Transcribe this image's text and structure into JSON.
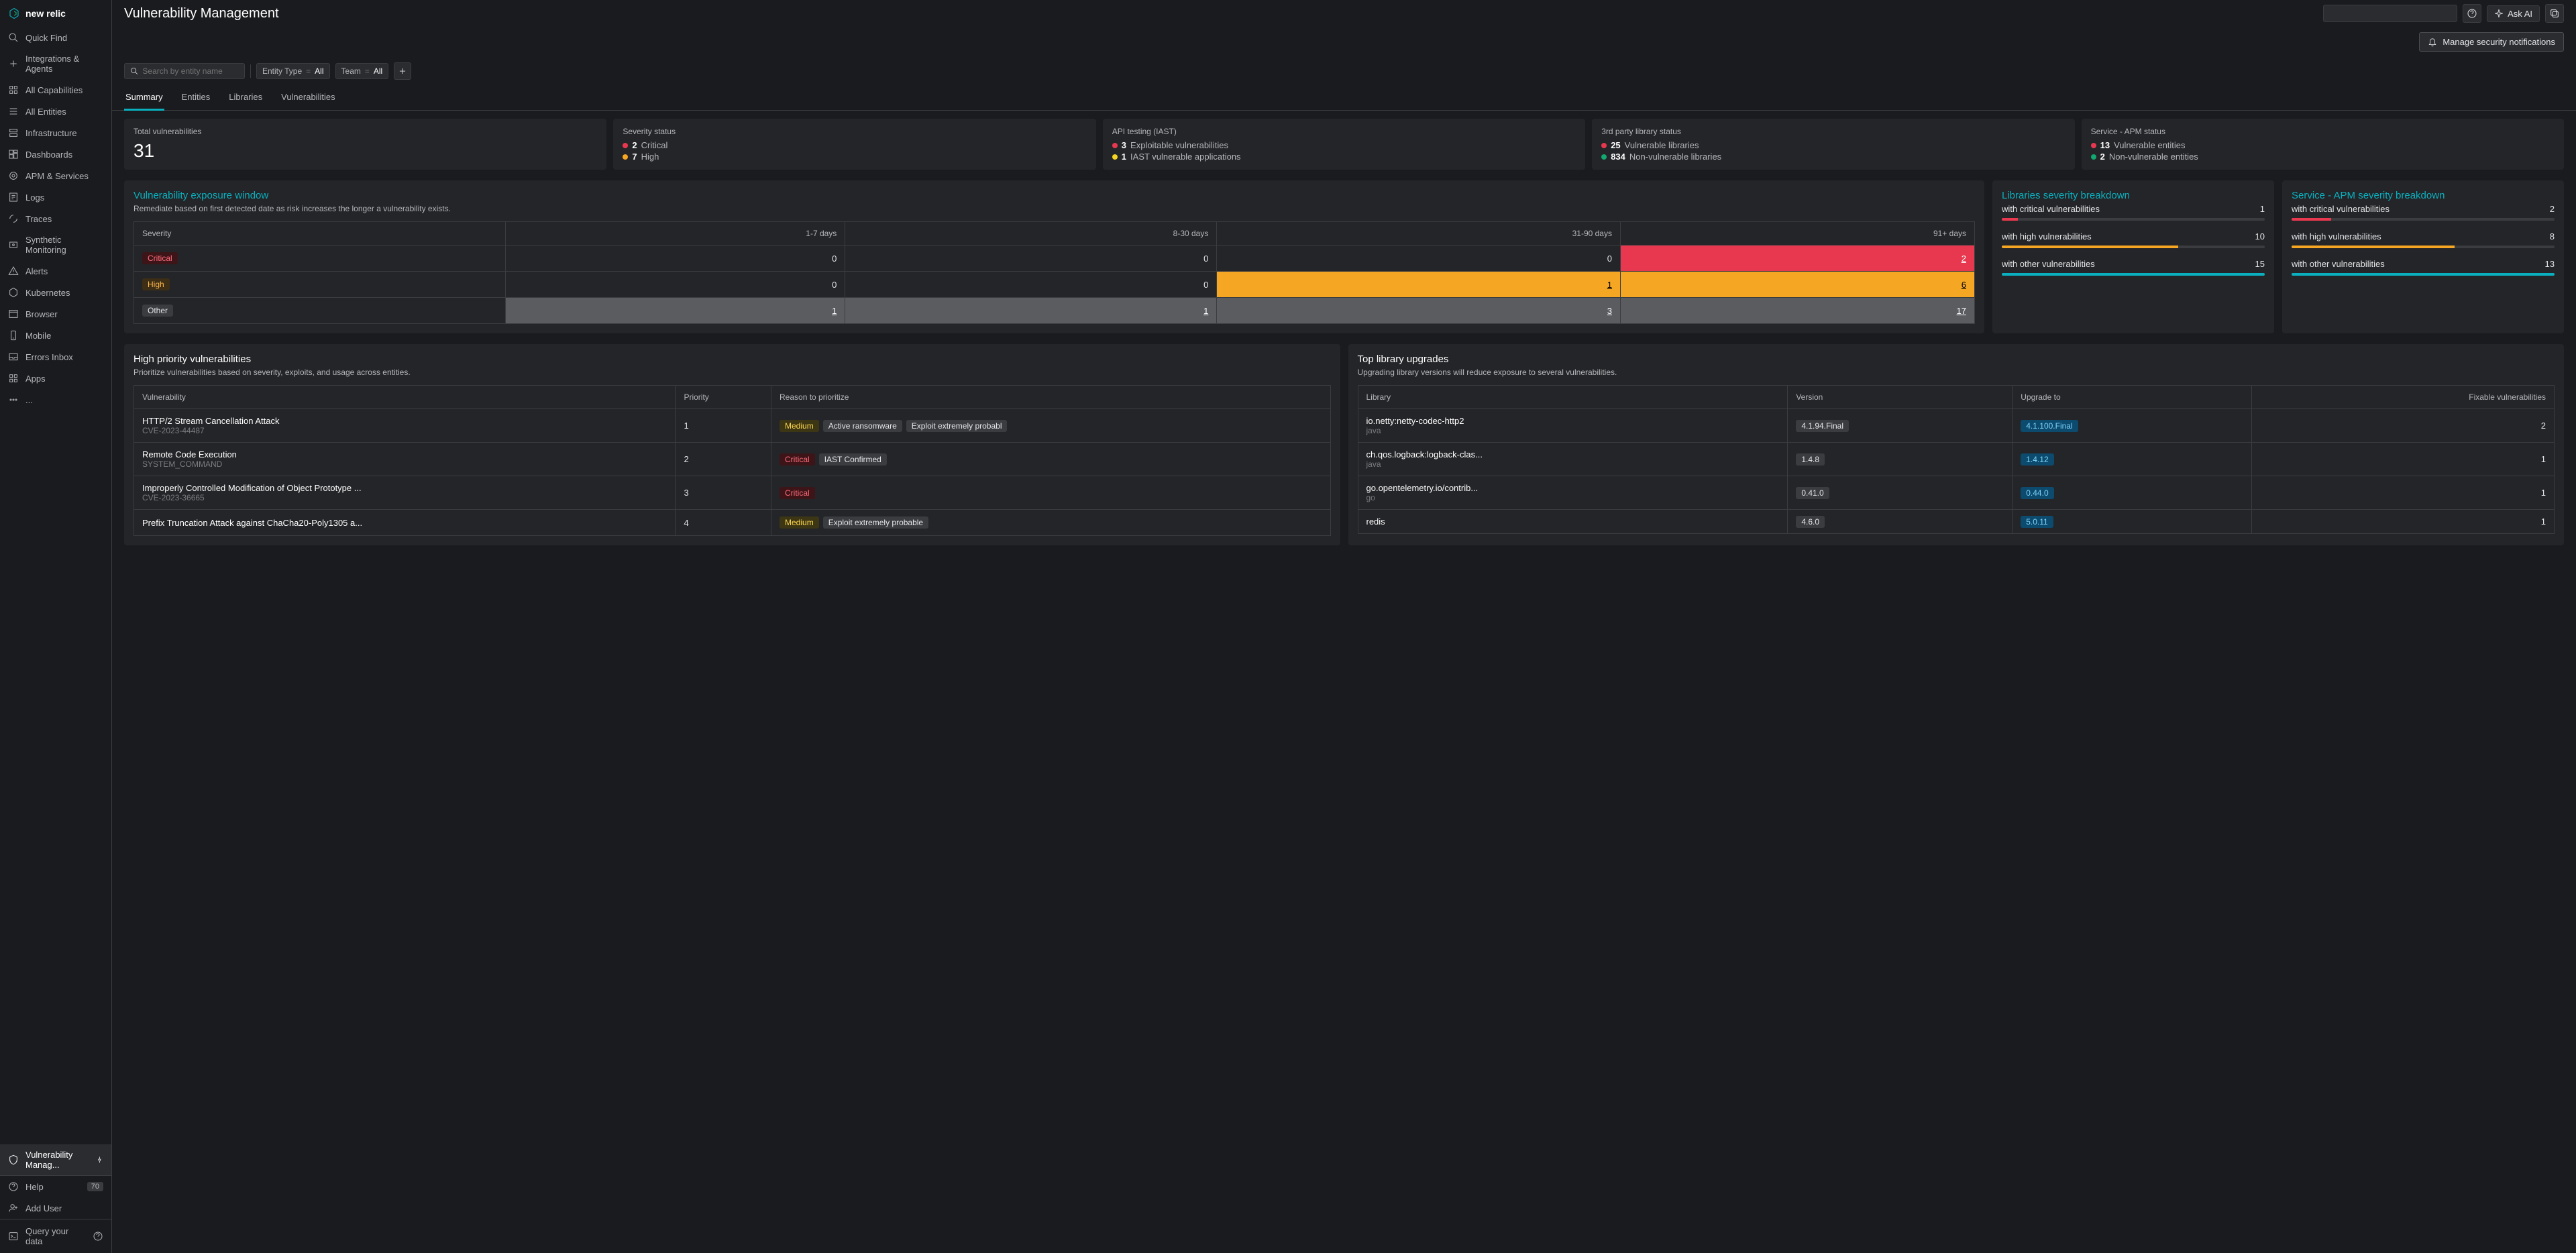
{
  "brand": "new relic",
  "header": {
    "title": "Vulnerability Management",
    "ask_ai": "Ask AI",
    "notif_button": "Manage security notifications"
  },
  "sidebar": {
    "items": [
      {
        "label": "Quick Find",
        "icon": "search-icon"
      },
      {
        "label": "Integrations & Agents",
        "icon": "plus-icon"
      },
      {
        "label": "All Capabilities",
        "icon": "grid-icon"
      },
      {
        "label": "All Entities",
        "icon": "list-icon"
      },
      {
        "label": "Infrastructure",
        "icon": "server-icon"
      },
      {
        "label": "Dashboards",
        "icon": "dashboard-icon"
      },
      {
        "label": "APM & Services",
        "icon": "apm-icon"
      },
      {
        "label": "Logs",
        "icon": "logs-icon"
      },
      {
        "label": "Traces",
        "icon": "traces-icon"
      },
      {
        "label": "Synthetic Monitoring",
        "icon": "synthetic-icon"
      },
      {
        "label": "Alerts",
        "icon": "alert-icon"
      },
      {
        "label": "Kubernetes",
        "icon": "kubernetes-icon"
      },
      {
        "label": "Browser",
        "icon": "browser-icon"
      },
      {
        "label": "Mobile",
        "icon": "mobile-icon"
      },
      {
        "label": "Errors Inbox",
        "icon": "inbox-icon"
      },
      {
        "label": "Apps",
        "icon": "apps-icon"
      },
      {
        "label": "...",
        "icon": "ellipsis-icon"
      }
    ],
    "active_label": "Vulnerability Manag...",
    "help_label": "Help",
    "help_badge": "70",
    "add_user": "Add User",
    "query_data": "Query your data"
  },
  "filters": {
    "search_placeholder": "Search by entity name",
    "chips": [
      {
        "key": "Entity Type",
        "op": "=",
        "val": "All"
      },
      {
        "key": "Team",
        "op": "=",
        "val": "All"
      }
    ]
  },
  "tabs": [
    "Summary",
    "Entities",
    "Libraries",
    "Vulnerabilities"
  ],
  "active_tab": "Summary",
  "stats": {
    "total": {
      "label": "Total vulnerabilities",
      "value": "31"
    },
    "severity": {
      "label": "Severity status",
      "rows": [
        {
          "dot": "red",
          "num": "2",
          "txt": "Critical"
        },
        {
          "dot": "orange",
          "num": "7",
          "txt": "High"
        }
      ]
    },
    "api": {
      "label": "API testing (IAST)",
      "rows": [
        {
          "dot": "red",
          "num": "3",
          "txt": "Exploitable vulnerabilities"
        },
        {
          "dot": "yellow",
          "num": "1",
          "txt": "IAST vulnerable applications"
        }
      ]
    },
    "third_party": {
      "label": "3rd party library status",
      "rows": [
        {
          "dot": "red",
          "num": "25",
          "txt": "Vulnerable libraries"
        },
        {
          "dot": "green",
          "num": "834",
          "txt": "Non-vulnerable libraries"
        }
      ]
    },
    "service": {
      "label": "Service - APM status",
      "rows": [
        {
          "dot": "red",
          "num": "13",
          "txt": "Vulnerable entities"
        },
        {
          "dot": "green",
          "num": "2",
          "txt": "Non-vulnerable entities"
        }
      ]
    }
  },
  "exposure": {
    "title": "Vulnerability exposure window",
    "subtitle": "Remediate based on first detected date as risk increases the longer a vulnerability exists.",
    "columns": [
      "Severity",
      "1-7 days",
      "8-30 days",
      "31-90 days",
      "91+ days"
    ],
    "rows": [
      {
        "sev": "Critical",
        "cls": "critical",
        "cells": [
          {
            "v": "0"
          },
          {
            "v": "0"
          },
          {
            "v": "0"
          },
          {
            "v": "2",
            "bg": "cell-red",
            "link": true
          }
        ]
      },
      {
        "sev": "High",
        "cls": "high",
        "cells": [
          {
            "v": "0"
          },
          {
            "v": "0"
          },
          {
            "v": "1",
            "bg": "cell-orange",
            "link": true
          },
          {
            "v": "6",
            "bg": "cell-orange",
            "link": true
          }
        ]
      },
      {
        "sev": "Other",
        "cls": "other",
        "cells": [
          {
            "v": "1",
            "bg": "cell-gray",
            "link": true
          },
          {
            "v": "1",
            "bg": "cell-gray",
            "link": true
          },
          {
            "v": "3",
            "bg": "cell-gray",
            "link": true
          },
          {
            "v": "17",
            "bg": "cell-gray",
            "link": true
          }
        ]
      }
    ]
  },
  "lib_breakdown": {
    "title": "Libraries severity breakdown",
    "items": [
      {
        "label": "with critical vulnerabilities",
        "count": "1",
        "fill": "red",
        "pct": 6
      },
      {
        "label": "with high vulnerabilities",
        "count": "10",
        "fill": "orange",
        "pct": 67
      },
      {
        "label": "with other vulnerabilities",
        "count": "15",
        "fill": "teal",
        "pct": 100
      }
    ]
  },
  "svc_breakdown": {
    "title": "Service - APM severity breakdown",
    "items": [
      {
        "label": "with critical vulnerabilities",
        "count": "2",
        "fill": "red",
        "pct": 15
      },
      {
        "label": "with high vulnerabilities",
        "count": "8",
        "fill": "orange",
        "pct": 62
      },
      {
        "label": "with other vulnerabilities",
        "count": "13",
        "fill": "teal",
        "pct": 100
      }
    ]
  },
  "priority": {
    "title": "High priority vulnerabilities",
    "subtitle": "Prioritize vulnerabilities based on severity, exploits, and usage across entities.",
    "columns": [
      "Vulnerability",
      "Priority",
      "Reason to prioritize"
    ],
    "rows": [
      {
        "name": "HTTP/2 Stream Cancellation Attack",
        "cve": "CVE-2023-44487",
        "priority": "1",
        "reasons": [
          {
            "txt": "Medium",
            "cls": "medium"
          },
          {
            "txt": "Active ransomware"
          },
          {
            "txt": "Exploit extremely probabl"
          }
        ]
      },
      {
        "name": "Remote Code Execution",
        "cve": "SYSTEM_COMMAND",
        "priority": "2",
        "reasons": [
          {
            "txt": "Critical",
            "cls": "critical"
          },
          {
            "txt": "IAST Confirmed"
          }
        ]
      },
      {
        "name": "Improperly Controlled Modification of Object Prototype ...",
        "cve": "CVE-2023-36665",
        "priority": "3",
        "reasons": [
          {
            "txt": "Critical",
            "cls": "critical"
          }
        ]
      },
      {
        "name": "Prefix Truncation Attack against ChaCha20-Poly1305 a...",
        "cve": "",
        "priority": "4",
        "reasons": [
          {
            "txt": "Medium",
            "cls": "medium"
          },
          {
            "txt": "Exploit extremely probable"
          }
        ]
      }
    ]
  },
  "upgrades": {
    "title": "Top library upgrades",
    "subtitle": "Upgrading library versions will reduce exposure to several vulnerabilities.",
    "columns": [
      "Library",
      "Version",
      "Upgrade to",
      "Fixable vulnerabilities"
    ],
    "rows": [
      {
        "lib": "io.netty:netty-codec-http2",
        "lang": "java",
        "ver": "4.1.94.Final",
        "to": "4.1.100.Final",
        "fix": "2"
      },
      {
        "lib": "ch.qos.logback:logback-clas...",
        "lang": "java",
        "ver": "1.4.8",
        "to": "1.4.12",
        "fix": "1"
      },
      {
        "lib": "go.opentelemetry.io/contrib...",
        "lang": "go",
        "ver": "0.41.0",
        "to": "0.44.0",
        "fix": "1"
      },
      {
        "lib": "redis",
        "lang": "",
        "ver": "4.6.0",
        "to": "5.0.11",
        "fix": "1"
      }
    ]
  },
  "chart_data": [
    {
      "type": "bar",
      "title": "Libraries severity breakdown",
      "categories": [
        "with critical vulnerabilities",
        "with high vulnerabilities",
        "with other vulnerabilities"
      ],
      "values": [
        1,
        10,
        15
      ]
    },
    {
      "type": "bar",
      "title": "Service - APM severity breakdown",
      "categories": [
        "with critical vulnerabilities",
        "with high vulnerabilities",
        "with other vulnerabilities"
      ],
      "values": [
        2,
        8,
        13
      ]
    },
    {
      "type": "table",
      "title": "Vulnerability exposure window",
      "columns": [
        "Severity",
        "1-7 days",
        "8-30 days",
        "31-90 days",
        "91+ days"
      ],
      "rows": [
        [
          "Critical",
          0,
          0,
          0,
          2
        ],
        [
          "High",
          0,
          0,
          1,
          6
        ],
        [
          "Other",
          1,
          1,
          3,
          17
        ]
      ]
    }
  ]
}
